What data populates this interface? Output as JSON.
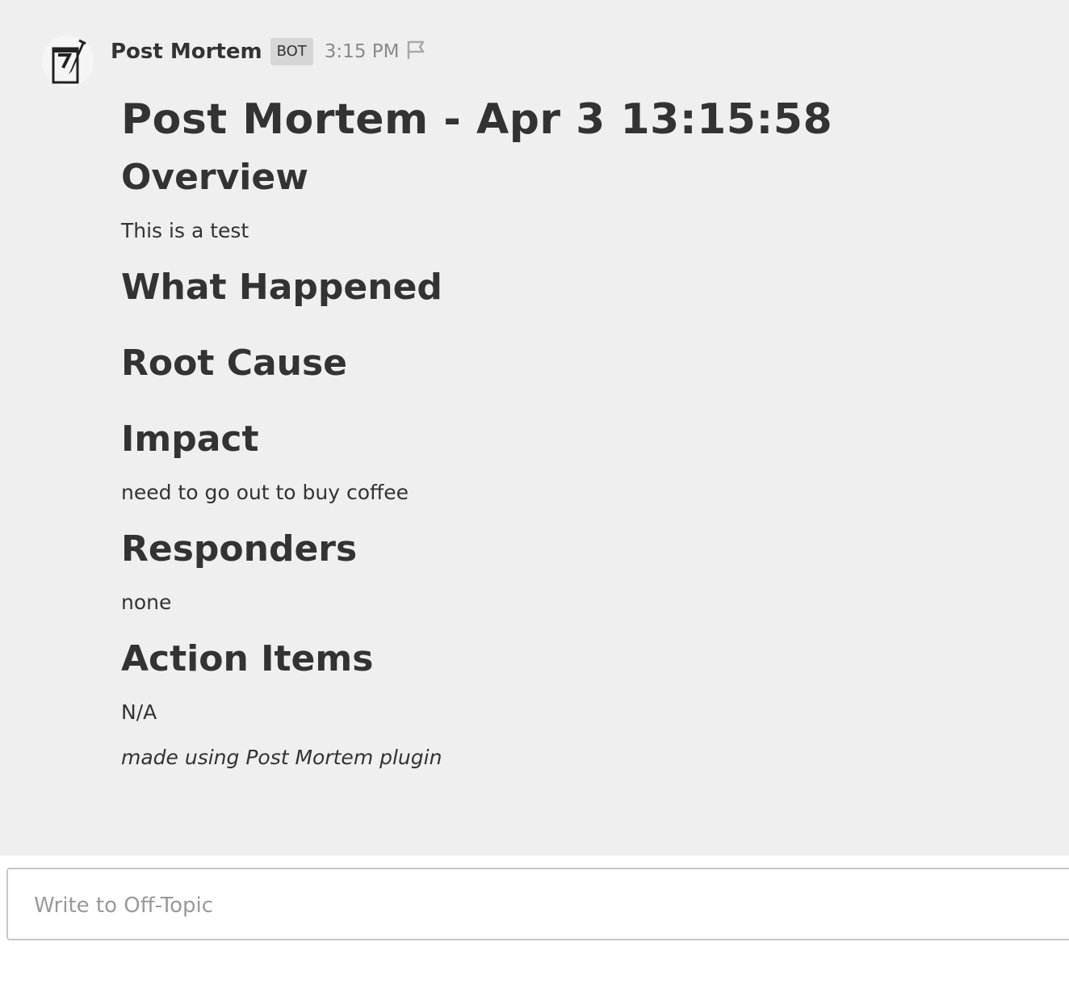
{
  "post": {
    "avatar_icon": "notepad-pencil-icon",
    "username": "Post Mortem",
    "badge": "BOT",
    "time": "3:15 PM",
    "flag_icon": "flag-icon",
    "title": "Post Mortem - Apr 3 13:15:58",
    "sections": [
      {
        "heading": "Overview",
        "body": "This is a test"
      },
      {
        "heading": "What Happened",
        "body": ""
      },
      {
        "heading": "Root Cause",
        "body": ""
      },
      {
        "heading": "Impact",
        "body": "need to go out to buy coffee"
      },
      {
        "heading": "Responders",
        "body": "none"
      },
      {
        "heading": "Action Items",
        "body": "N/A"
      }
    ],
    "footer": "made using Post Mortem plugin"
  },
  "composer": {
    "placeholder": "Write to Off-Topic",
    "value": ""
  }
}
